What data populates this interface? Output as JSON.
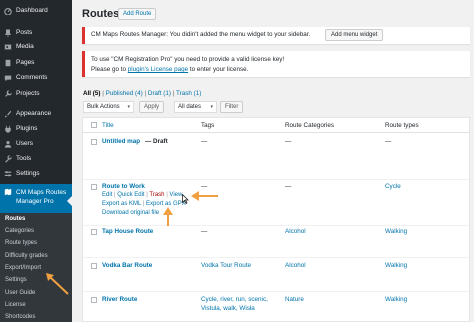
{
  "sidebar": {
    "items": [
      {
        "label": "Dashboard",
        "icon": "dashboard-icon"
      },
      {
        "label": "Posts",
        "icon": "pin-icon"
      },
      {
        "label": "Media",
        "icon": "media-icon"
      },
      {
        "label": "Pages",
        "icon": "page-icon"
      },
      {
        "label": "Comments",
        "icon": "comment-icon"
      },
      {
        "label": "Projects",
        "icon": "wrench-icon"
      },
      {
        "label": "Appearance",
        "icon": "brush-icon"
      },
      {
        "label": "Plugins",
        "icon": "plugin-icon"
      },
      {
        "label": "Users",
        "icon": "user-icon"
      },
      {
        "label": "Tools",
        "icon": "tools-icon"
      },
      {
        "label": "Settings",
        "icon": "settings-icon"
      }
    ],
    "active": {
      "label": "CM Maps Routes Manager Pro",
      "icon": "map-icon"
    },
    "submenu": [
      "Routes",
      "Categories",
      "Route types",
      "Difficulty grades",
      "Export/Import",
      "Settings",
      "User Guide",
      "License",
      "Shortcodes"
    ]
  },
  "page": {
    "title": "Routes",
    "add_new": "Add Route"
  },
  "notices": {
    "menu_widget": {
      "text": "CM Maps Routes Manager: You didin't added the menu widget to your sidebar.",
      "button": "Add menu widget"
    },
    "license": {
      "line1": "To use \"CM Registration Pro\" you need to provide a valid license key!",
      "line2_pre": "Please go to ",
      "line2_link": "plugin's License page",
      "line2_post": " to enter your license."
    }
  },
  "filters": {
    "all": "All (5)",
    "published": "Published (4)",
    "draft": "Draft (1)",
    "trash": "Trash (1)",
    "sep": "|"
  },
  "tablenav": {
    "bulk_actions": "Bulk Actions",
    "apply": "Apply",
    "all_dates": "All dates",
    "filter": "Filter"
  },
  "table": {
    "columns": [
      "Title",
      "Tags",
      "Route Categories",
      "Route types"
    ],
    "rows": [
      {
        "title": "Untitled map",
        "state": " — Draft",
        "tags": "—",
        "categories": "—",
        "types": "—"
      },
      {
        "title": "Route to Work",
        "state": "",
        "tags": "—",
        "categories": "—",
        "types": "Cycle"
      },
      {
        "title": "Tap House Route",
        "state": "",
        "tags": "—",
        "categories": "Alcohol",
        "types": "Walking"
      },
      {
        "title": "Vodka Bar Route",
        "state": "",
        "tags": "Vodka Tour Route",
        "categories": "Alcohol",
        "types": "Walking"
      },
      {
        "title": "River Route",
        "state": "",
        "tags_l1": "Cycle, river, run, scenic,",
        "tags_l2": "Vistula, walk, Wisła",
        "categories": "Nature",
        "types": "Walking"
      }
    ],
    "row_actions": {
      "edit": "Edit",
      "quick_edit": "Quick Edit",
      "trash": "Trash",
      "view": "View",
      "export_kml": "Export as KML",
      "export_gpx": "Export as GPX",
      "download": "Download original file",
      "sep": "|"
    }
  },
  "colors": {
    "sidebar_bg": "#23282d",
    "active_bg": "#0073aa",
    "link": "#0073aa",
    "notice_border": "#dc3232",
    "arrow": "#f0a040"
  }
}
